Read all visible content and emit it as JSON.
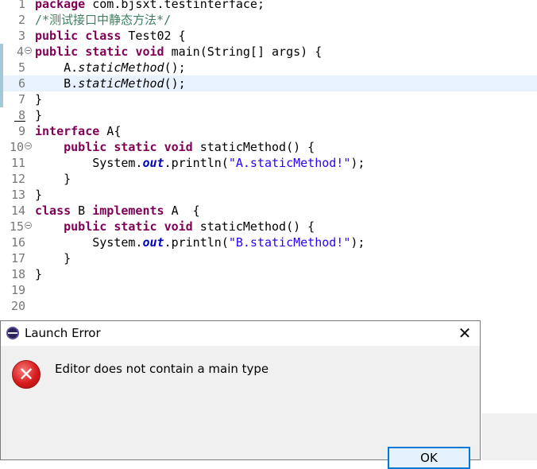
{
  "editor": {
    "lines": [
      {
        "num": "1",
        "parts": [
          {
            "t": "package",
            "c": "kw"
          },
          {
            "t": " com.bjsxt.testinterface;",
            "c": ""
          }
        ]
      },
      {
        "num": "2",
        "parts": [
          {
            "t": "/*测试接口中静态方法*/",
            "c": "cm"
          }
        ]
      },
      {
        "num": "3",
        "parts": [
          {
            "t": "public",
            "c": "kw"
          },
          {
            "t": " ",
            "c": ""
          },
          {
            "t": "class",
            "c": "kw"
          },
          {
            "t": " Test02 {",
            "c": ""
          }
        ]
      },
      {
        "num": "4",
        "fold": true,
        "parts": [
          {
            "t": "public",
            "c": "kw"
          },
          {
            "t": " ",
            "c": ""
          },
          {
            "t": "static",
            "c": "kw"
          },
          {
            "t": " ",
            "c": ""
          },
          {
            "t": "void",
            "c": "kw"
          },
          {
            "t": " main(String[] args) {",
            "c": ""
          }
        ]
      },
      {
        "num": "5",
        "parts": [
          {
            "t": "    A.",
            "c": ""
          },
          {
            "t": "staticMethod",
            "c": "it"
          },
          {
            "t": "();",
            "c": ""
          }
        ]
      },
      {
        "num": "6",
        "current": true,
        "parts": [
          {
            "t": "    B.",
            "c": ""
          },
          {
            "t": "staticMethod",
            "c": "it"
          },
          {
            "t": "();",
            "c": ""
          }
        ]
      },
      {
        "num": "7",
        "parts": [
          {
            "t": "}",
            "c": ""
          }
        ]
      },
      {
        "num": "8",
        "parts": [
          {
            "t": "}",
            "c": ""
          }
        ]
      },
      {
        "num": "9",
        "parts": [
          {
            "t": "interface",
            "c": "kw"
          },
          {
            "t": " A{",
            "c": ""
          }
        ]
      },
      {
        "num": "10",
        "fold": true,
        "parts": [
          {
            "t": "    ",
            "c": ""
          },
          {
            "t": "public",
            "c": "kw"
          },
          {
            "t": " ",
            "c": ""
          },
          {
            "t": "static",
            "c": "kw"
          },
          {
            "t": " ",
            "c": ""
          },
          {
            "t": "void",
            "c": "kw"
          },
          {
            "t": " staticMethod() {",
            "c": ""
          }
        ]
      },
      {
        "num": "11",
        "parts": [
          {
            "t": "        System.",
            "c": ""
          },
          {
            "t": "out",
            "c": "fld"
          },
          {
            "t": ".println(",
            "c": ""
          },
          {
            "t": "\"A.staticMethod!\"",
            "c": "str"
          },
          {
            "t": ");",
            "c": ""
          }
        ]
      },
      {
        "num": "12",
        "parts": [
          {
            "t": "    }",
            "c": ""
          }
        ]
      },
      {
        "num": "13",
        "parts": [
          {
            "t": "}",
            "c": ""
          }
        ]
      },
      {
        "num": "14",
        "parts": [
          {
            "t": "class",
            "c": "kw"
          },
          {
            "t": " B ",
            "c": ""
          },
          {
            "t": "implements",
            "c": "kw"
          },
          {
            "t": " A  {",
            "c": ""
          }
        ]
      },
      {
        "num": "15",
        "fold": true,
        "parts": [
          {
            "t": "    ",
            "c": ""
          },
          {
            "t": "public",
            "c": "kw"
          },
          {
            "t": " ",
            "c": ""
          },
          {
            "t": "static",
            "c": "kw"
          },
          {
            "t": " ",
            "c": ""
          },
          {
            "t": "void",
            "c": "kw"
          },
          {
            "t": " staticMethod() {",
            "c": ""
          }
        ]
      },
      {
        "num": "16",
        "parts": [
          {
            "t": "        System.",
            "c": ""
          },
          {
            "t": "out",
            "c": "fld"
          },
          {
            "t": ".println(",
            "c": ""
          },
          {
            "t": "\"B.staticMethod!\"",
            "c": "str"
          },
          {
            "t": ");",
            "c": ""
          }
        ]
      },
      {
        "num": "17",
        "parts": [
          {
            "t": "    }",
            "c": ""
          }
        ]
      },
      {
        "num": "18",
        "parts": [
          {
            "t": "}",
            "c": ""
          }
        ]
      },
      {
        "num": "19",
        "parts": []
      },
      {
        "num": "20",
        "parts": []
      }
    ],
    "colors": {
      "keyword": "#7f0055",
      "comment": "#3f7f5f",
      "string": "#2a00ff",
      "field": "#0000c0",
      "current_line": "#e8f2fe"
    }
  },
  "dialog": {
    "title": "Launch Error",
    "title_icon": "eclipse-icon",
    "close_label": "✕",
    "error_icon": "error-icon",
    "error_glyph": "✕",
    "message": "Editor does not contain a main type",
    "ok_label": "OK"
  }
}
